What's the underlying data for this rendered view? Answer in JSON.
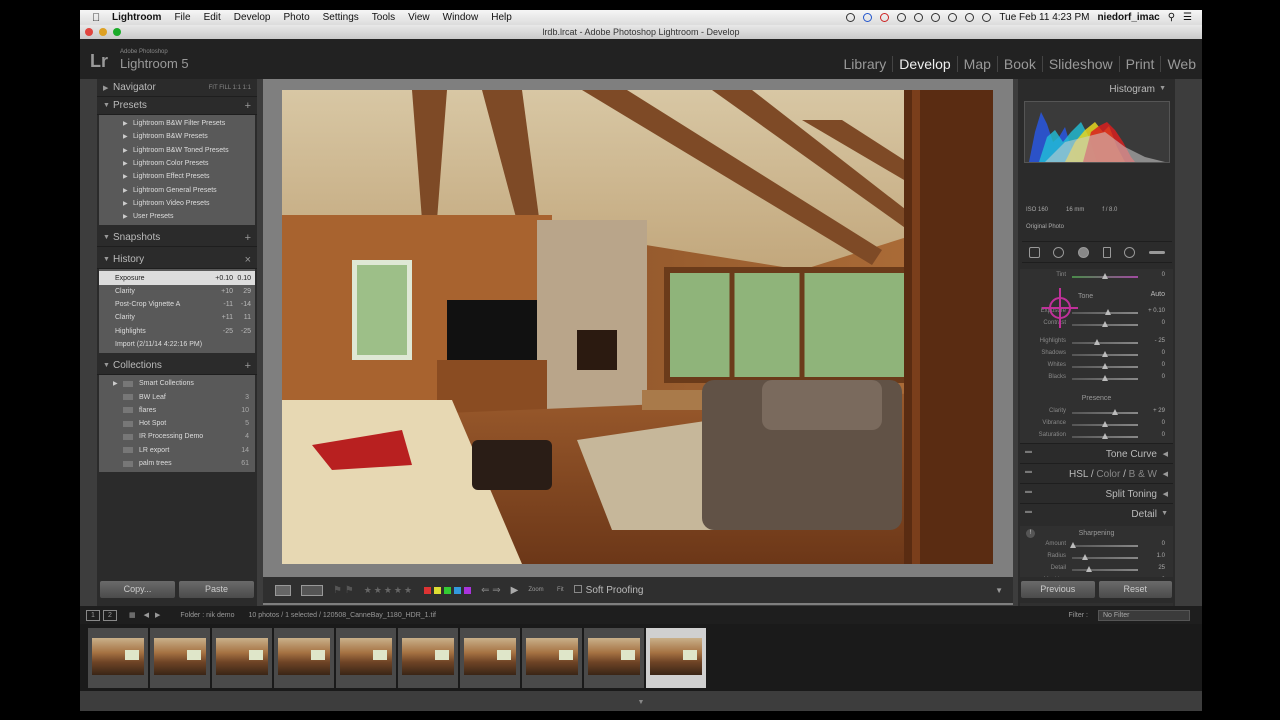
{
  "menubar": {
    "app_name": "Lightroom",
    "menus": [
      "File",
      "Edit",
      "Develop",
      "Photo",
      "Settings",
      "Tools",
      "View",
      "Window",
      "Help"
    ],
    "clock": "Tue Feb 11  4:23 PM",
    "user": "niedorf_imac"
  },
  "window": {
    "title": "lrdb.lrcat - Adobe Photoshop Lightroom - Develop"
  },
  "lr": {
    "logo": "Lr",
    "brand_small": "Adobe Photoshop",
    "brand": "Lightroom 5",
    "modules": [
      "Library",
      "Develop",
      "Map",
      "Book",
      "Slideshow",
      "Print",
      "Web"
    ],
    "active_module": "Develop"
  },
  "left": {
    "navigator": {
      "title": "Navigator",
      "zoom_opts": "FIT  FILL  1:1  1:1"
    },
    "presets": {
      "title": "Presets",
      "items": [
        "Lightroom B&W Filter Presets",
        "Lightroom B&W Presets",
        "Lightroom B&W Toned Presets",
        "Lightroom Color Presets",
        "Lightroom Effect Presets",
        "Lightroom General Presets",
        "Lightroom Video Presets",
        "User Presets"
      ]
    },
    "snapshots": {
      "title": "Snapshots"
    },
    "history": {
      "title": "History",
      "items": [
        {
          "name": "Exposure",
          "v1": "+0.10",
          "v2": "0.10"
        },
        {
          "name": "Clarity",
          "v1": "+10",
          "v2": "29"
        },
        {
          "name": "Post-Crop Vignette A",
          "v1": "-11",
          "v2": "-14"
        },
        {
          "name": "Clarity",
          "v1": "+11",
          "v2": "11"
        },
        {
          "name": "Highlights",
          "v1": "-25",
          "v2": "-25"
        },
        {
          "name": "Import (2/11/14 4:22:16 PM)",
          "v1": "",
          "v2": ""
        }
      ]
    },
    "collections": {
      "title": "Collections",
      "items": [
        {
          "name": "Smart Collections",
          "count": ""
        },
        {
          "name": "BW Leaf",
          "count": "3"
        },
        {
          "name": "flares",
          "count": "10"
        },
        {
          "name": "Hot Spot",
          "count": "5"
        },
        {
          "name": "IR Processing Demo",
          "count": "4"
        },
        {
          "name": "LR export",
          "count": "14"
        },
        {
          "name": "palm trees",
          "count": "61"
        }
      ]
    },
    "buttons": {
      "copy": "Copy...",
      "paste": "Paste"
    }
  },
  "right": {
    "histogram": {
      "title": "Histogram",
      "iso": "ISO 160",
      "focal": "16 mm",
      "aperture": "f / 8.0",
      "original": "Original Photo"
    },
    "basic": {
      "tone_label": "Tone",
      "auto": "Auto",
      "tint_label": "Tint",
      "tint_val": "0",
      "sliders": [
        {
          "label": "Exposure",
          "value": "+ 0.10",
          "pos": 0.55
        },
        {
          "label": "Contrast",
          "value": "0",
          "pos": 0.5
        },
        {
          "label": "Highlights",
          "value": "- 25",
          "pos": 0.38
        },
        {
          "label": "Shadows",
          "value": "0",
          "pos": 0.5
        },
        {
          "label": "Whites",
          "value": "0",
          "pos": 0.5
        },
        {
          "label": "Blacks",
          "value": "0",
          "pos": 0.5
        }
      ],
      "presence_label": "Presence",
      "presence": [
        {
          "label": "Clarity",
          "value": "+ 29",
          "pos": 0.65
        },
        {
          "label": "Vibrance",
          "value": "0",
          "pos": 0.5
        },
        {
          "label": "Saturation",
          "value": "0",
          "pos": 0.5
        }
      ]
    },
    "sections": {
      "tone_curve": "Tone Curve",
      "hsl": "HSL",
      "color": "Color",
      "bw": "B & W",
      "split": "Split Toning",
      "detail": "Detail"
    },
    "detail": {
      "sharpening": "Sharpening",
      "sliders": [
        {
          "label": "Amount",
          "value": "0",
          "pos": 0.02
        },
        {
          "label": "Radius",
          "value": "1.0",
          "pos": 0.2
        },
        {
          "label": "Detail",
          "value": "25",
          "pos": 0.25
        },
        {
          "label": "Masking",
          "value": "0",
          "pos": 0.02
        }
      ],
      "noise": "Noise Reduction"
    },
    "buttons": {
      "previous": "Previous",
      "reset": "Reset"
    }
  },
  "toolbar": {
    "zoom_label": "Zoom",
    "fit": "Fit",
    "soft_proofing": "Soft Proofing",
    "label_colors": [
      "#d33",
      "#dd3",
      "#3c3",
      "#39d",
      "#a3d"
    ]
  },
  "filmstrip": {
    "page1": "1",
    "page2": "2",
    "source": "Folder : nik demo",
    "count": "10 photos / 1 selected / 120508_CanneBay_1180_HDR_1.tif",
    "filter_label": "Filter :",
    "filter_value": "No Filter",
    "thumb_count": 10,
    "selected_index": 9
  }
}
